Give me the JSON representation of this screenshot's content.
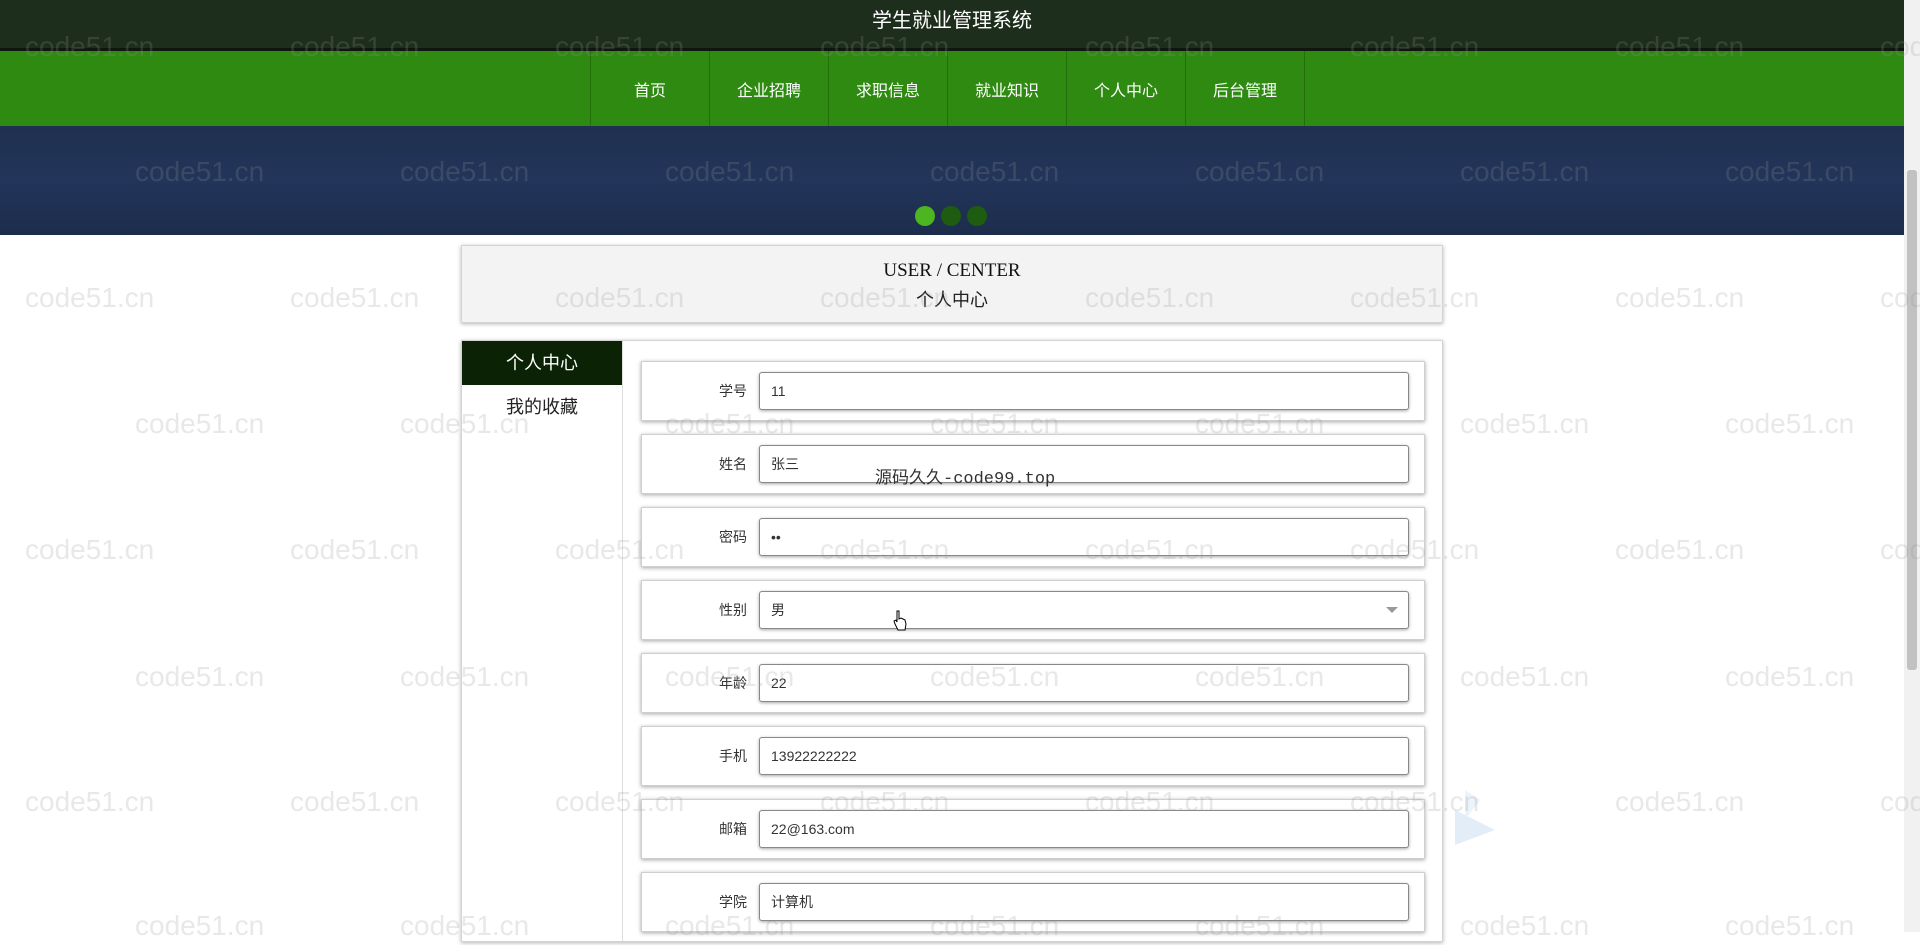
{
  "header": {
    "title": "学生就业管理系统"
  },
  "nav": {
    "items": [
      {
        "label": "首页"
      },
      {
        "label": "企业招聘"
      },
      {
        "label": "求职信息"
      },
      {
        "label": "就业知识"
      },
      {
        "label": "个人中心"
      },
      {
        "label": "后台管理"
      }
    ]
  },
  "banner": {
    "dots_count": 3,
    "active_dot": 1
  },
  "page_title": {
    "en": "USER / CENTER",
    "zh": "个人中心"
  },
  "sidebar": {
    "items": [
      {
        "label": "个人中心",
        "active": true
      },
      {
        "label": "我的收藏",
        "active": false
      }
    ]
  },
  "form": {
    "fields": [
      {
        "label": "学号",
        "value": "11"
      },
      {
        "label": "姓名",
        "value": "张三"
      },
      {
        "label": "密码",
        "value": "••"
      },
      {
        "label": "性别",
        "value": "男",
        "type": "select"
      },
      {
        "label": "年龄",
        "value": "22"
      },
      {
        "label": "手机",
        "value": "13922222222"
      },
      {
        "label": "邮箱",
        "value": "22@163.com"
      },
      {
        "label": "学院",
        "value": "计算机"
      }
    ]
  },
  "overlay_text": "源码久久-code99.top",
  "watermark": "code51.cn",
  "colors": {
    "topbar": "#1e2e1c",
    "nav": "#2f8a12",
    "sidebar_active": "#0b2205",
    "dot_active": "#4cb51f"
  }
}
